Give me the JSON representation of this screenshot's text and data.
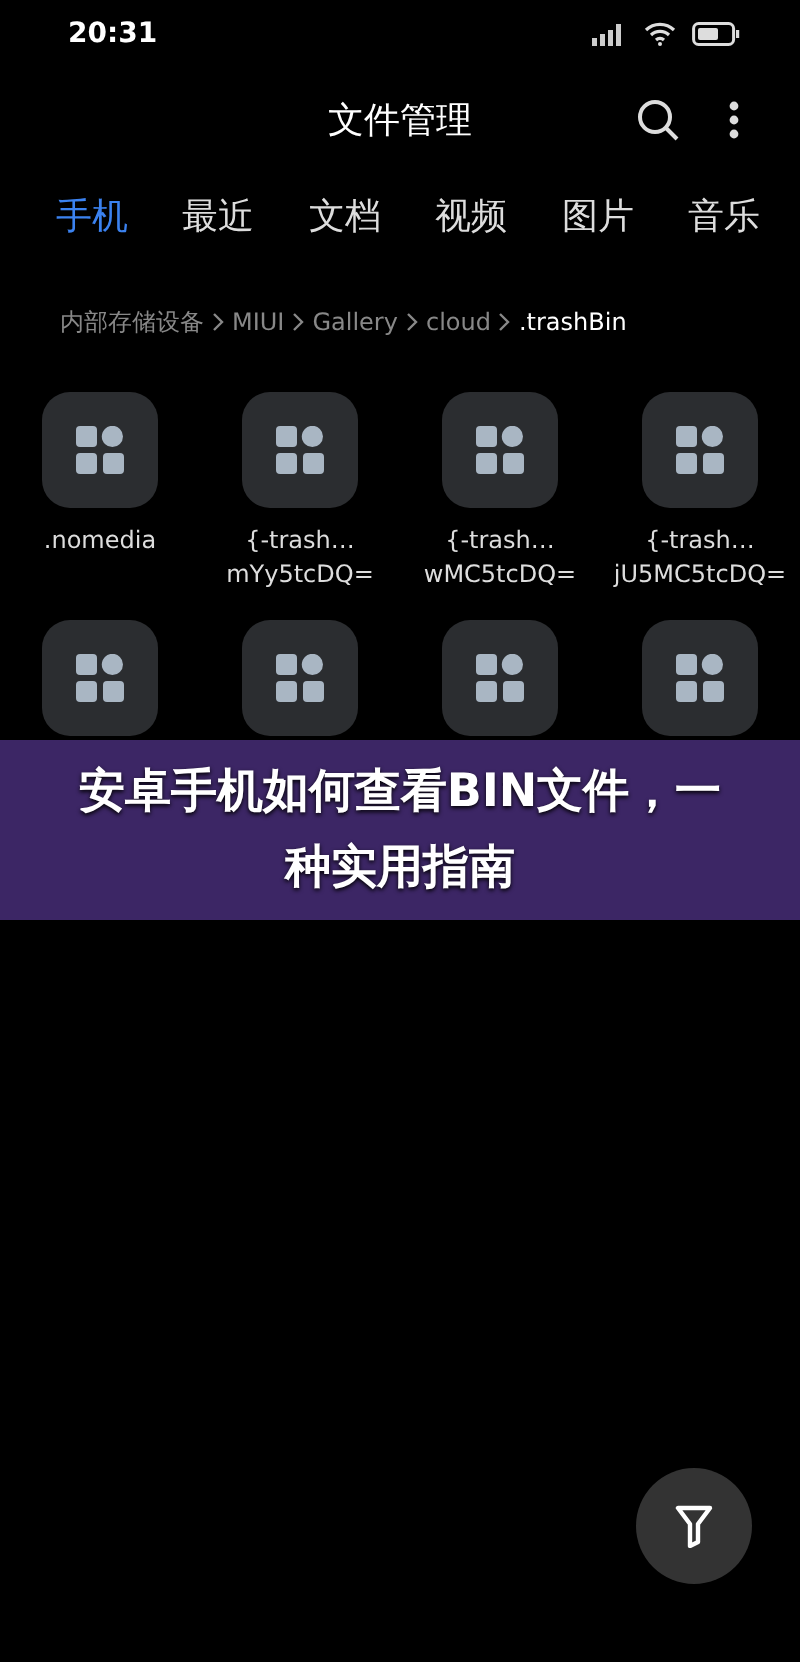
{
  "status_bar": {
    "time": "20:31"
  },
  "app_bar": {
    "title": "文件管理"
  },
  "tabs": [
    {
      "label": "手机",
      "selected": true
    },
    {
      "label": "最近",
      "selected": false
    },
    {
      "label": "文档",
      "selected": false
    },
    {
      "label": "视频",
      "selected": false
    },
    {
      "label": "图片",
      "selected": false
    },
    {
      "label": "音乐",
      "selected": false
    }
  ],
  "breadcrumb": [
    {
      "label": "内部存储设备",
      "selected": false
    },
    {
      "label": "MIUI",
      "selected": false
    },
    {
      "label": "Gallery",
      "selected": false
    },
    {
      "label": "cloud",
      "selected": false
    },
    {
      "label": ".trashBin",
      "selected": true
    }
  ],
  "files": [
    {
      "kind": "file",
      "lines": [
        ".nomedia"
      ]
    },
    {
      "kind": "file",
      "lines": [
        "{-trash…",
        "mYy5tcDQ="
      ]
    },
    {
      "kind": "file",
      "lines": [
        "{-trash…",
        "wMC5tcDQ="
      ]
    },
    {
      "kind": "file",
      "lines": [
        "{-trash…",
        "jU5MC5tcDQ="
      ]
    },
    {
      "kind": "file"
    },
    {
      "kind": "file"
    },
    {
      "kind": "file"
    },
    {
      "kind": "file"
    }
  ],
  "banner": {
    "title": "安卓手机如何查看BIN文件，一种实用指南"
  }
}
